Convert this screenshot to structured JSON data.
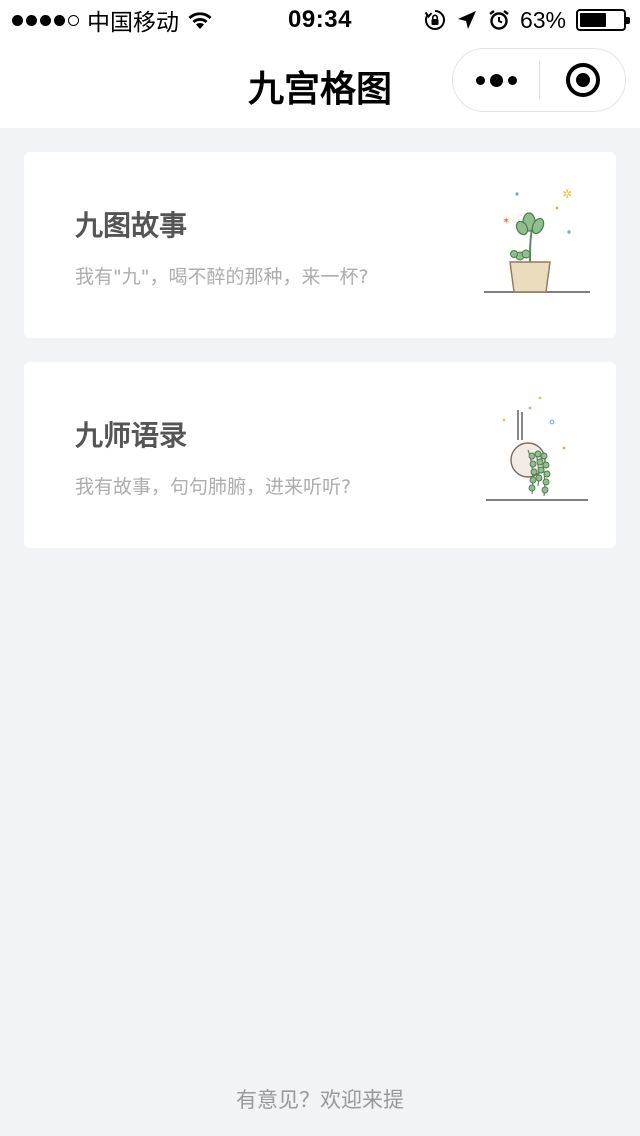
{
  "status_bar": {
    "carrier": "中国移动",
    "time": "09:34",
    "battery_percent": "63%",
    "battery_level": 0.63,
    "signal_bars": 4,
    "icons": [
      "signal-icon",
      "wifi-icon",
      "orientation-lock-icon",
      "location-icon",
      "alarm-icon",
      "battery-icon"
    ]
  },
  "navbar": {
    "title": "九宫格图",
    "capsule": {
      "more_icon": "more-dots-icon",
      "close_icon": "target-circle-icon"
    }
  },
  "cards": [
    {
      "title": "九图故事",
      "subtitle": "我有\"九\"，喝不醉的那种，来一杯?",
      "illustration": "potted-plant-illustration"
    },
    {
      "title": "九师语录",
      "subtitle": "我有故事，句句肺腑，进来听听?",
      "illustration": "hanging-plant-illustration"
    }
  ],
  "footer": {
    "feedback_link": "有意见？欢迎来提"
  },
  "colors": {
    "background": "#f2f3f7",
    "card": "#ffffff",
    "title": "#555555",
    "subtitle": "#adadad",
    "footer": "#999999"
  }
}
